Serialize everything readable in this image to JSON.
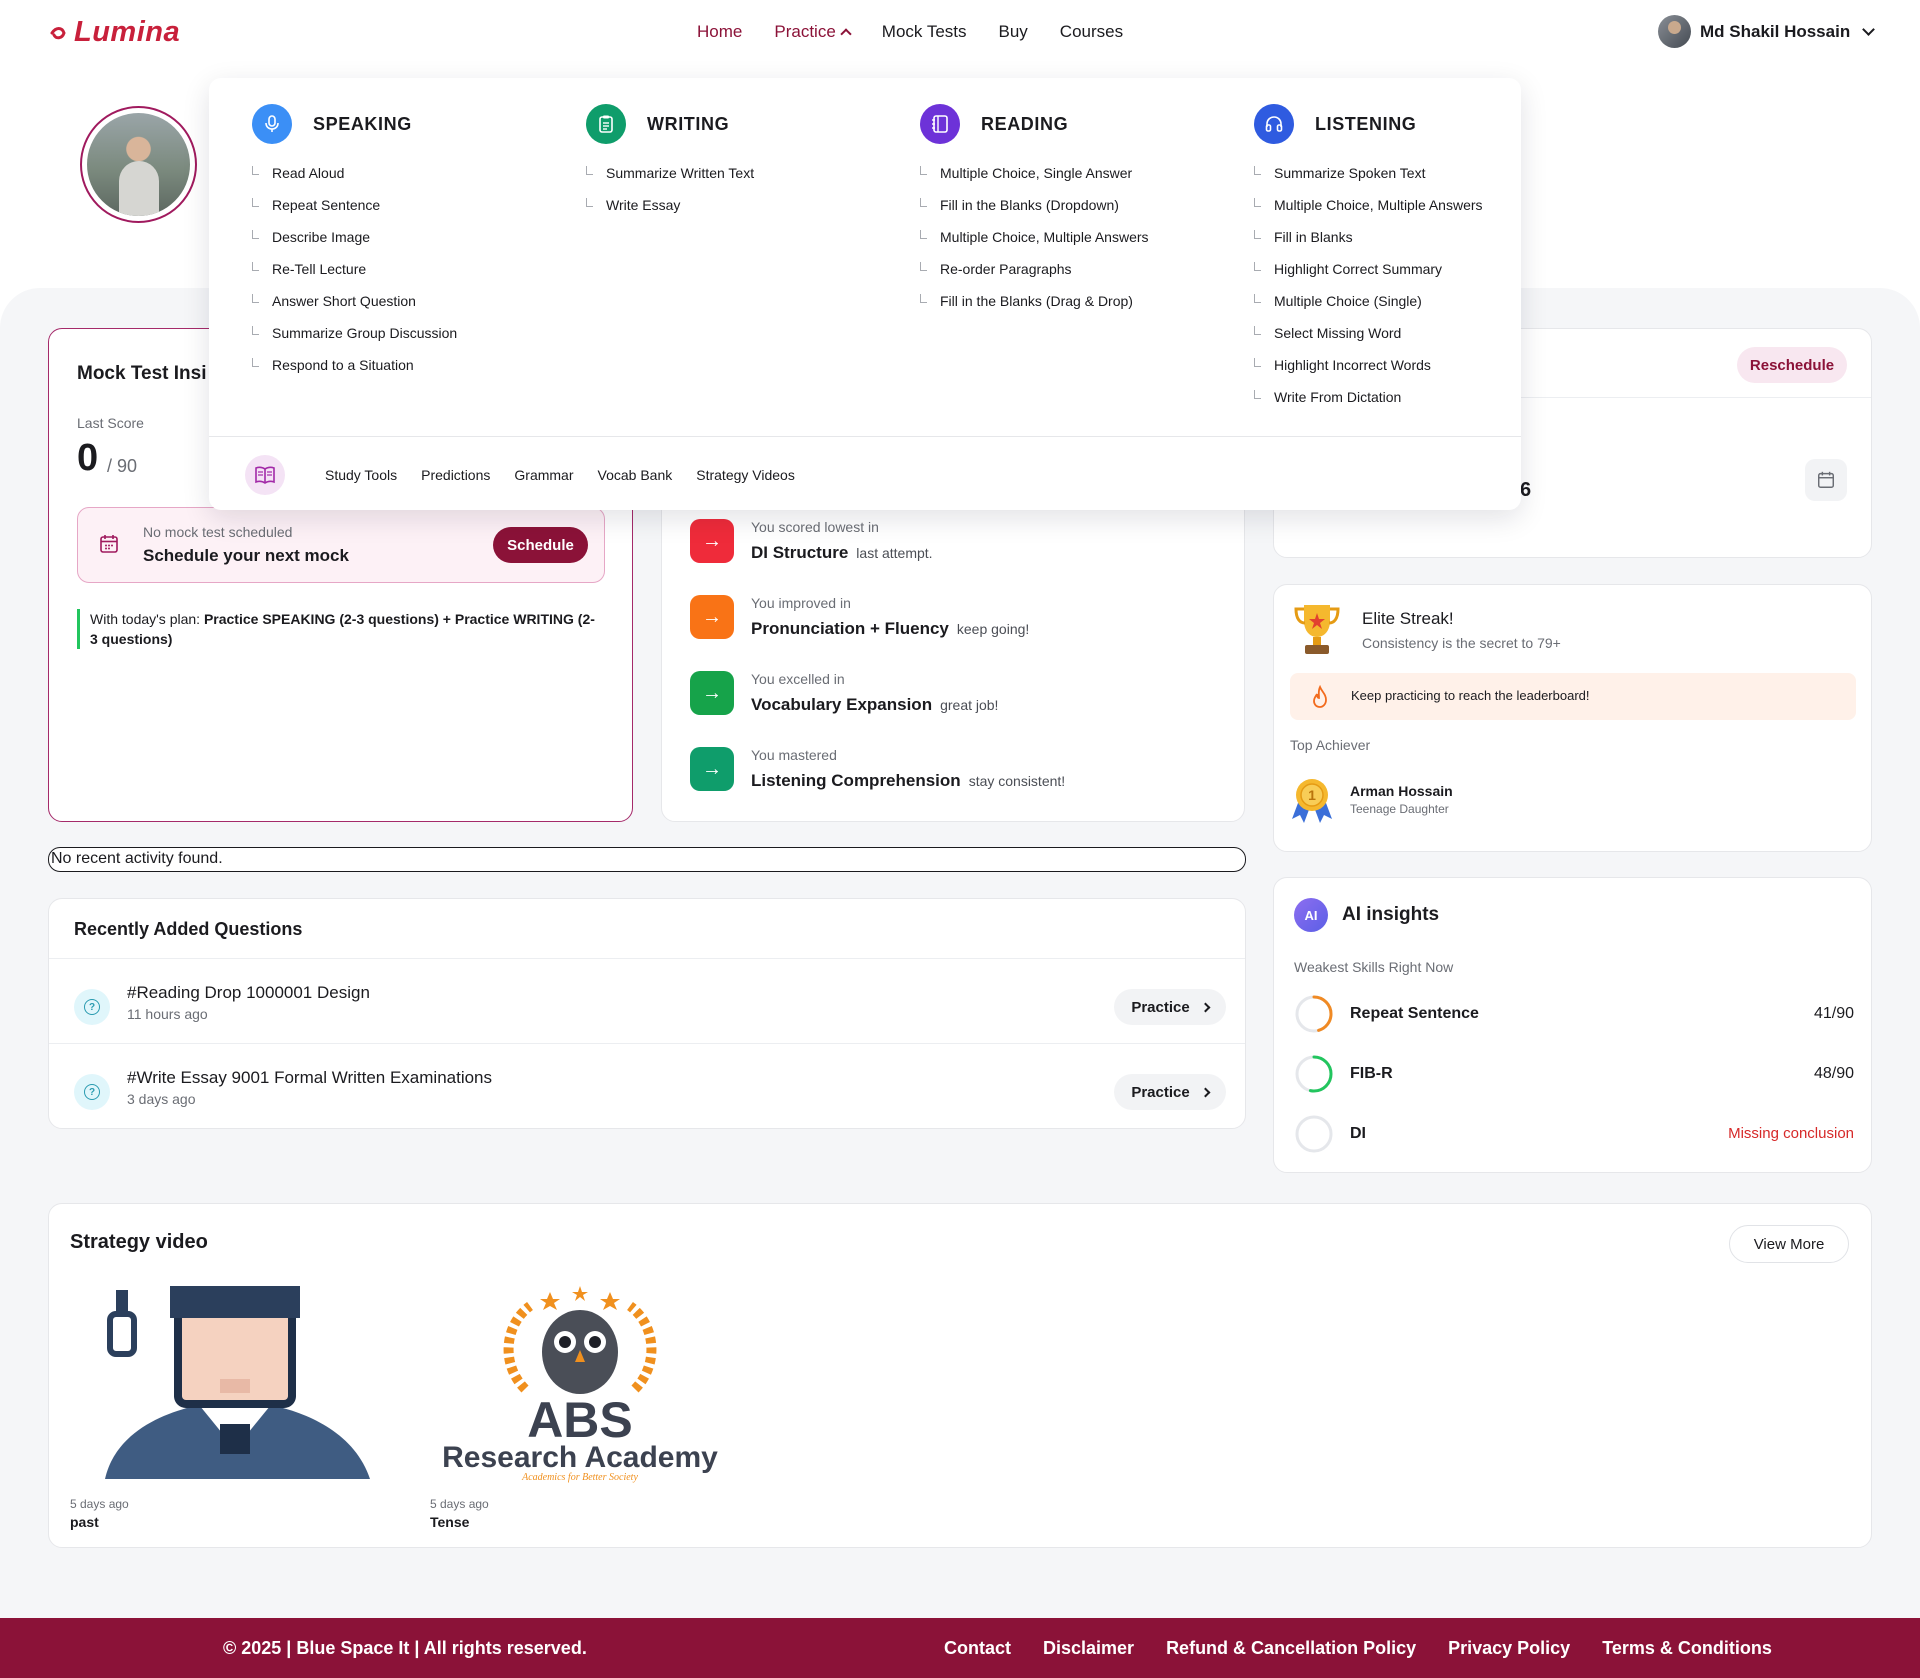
{
  "header": {
    "logo": "Lumina",
    "nav": [
      {
        "label": "Home",
        "active": true
      },
      {
        "label": "Practice",
        "active": true
      },
      {
        "label": "Mock Tests",
        "active": false
      },
      {
        "label": "Buy",
        "active": false
      },
      {
        "label": "Courses",
        "active": false
      }
    ],
    "user_name": "Md Shakil Hossain"
  },
  "colors": {
    "brand": "#8b1238",
    "logo": "#c8203b",
    "speaking": "#3b8ff6",
    "writing": "#0f9d6b",
    "reading": "#6d32d8",
    "listening": "#2f5be0"
  },
  "mega_menu": {
    "columns": [
      {
        "title": "SPEAKING",
        "icon": "microphone-icon",
        "items": [
          "Read Aloud",
          "Repeat Sentence",
          "Describe Image",
          "Re-Tell Lecture",
          "Answer Short Question",
          "Summarize Group Discussion",
          "Respond to a Situation"
        ]
      },
      {
        "title": "WRITING",
        "icon": "clipboard-icon",
        "items": [
          "Summarize Written Text",
          "Write Essay"
        ]
      },
      {
        "title": "READING",
        "icon": "notebook-icon",
        "items": [
          "Multiple Choice, Single Answer",
          "Fill in the Blanks (Dropdown)",
          "Multiple Choice, Multiple Answers",
          "Re-order Paragraphs",
          "Fill in the Blanks (Drag & Drop)"
        ]
      },
      {
        "title": "LISTENING",
        "icon": "headphones-icon",
        "items": [
          "Summarize Spoken Text",
          "Multiple Choice, Multiple Answers",
          "Fill in Blanks",
          "Highlight Correct Summary",
          "Multiple Choice (Single)",
          "Select Missing Word",
          "Highlight Incorrect Words",
          "Write From Dictation"
        ]
      }
    ],
    "bottom_links": [
      "Study Tools",
      "Predictions",
      "Grammar",
      "Vocab Bank",
      "Strategy Videos"
    ]
  },
  "mock_card": {
    "title": "Mock Test Insi",
    "last_score_label": "Last Score",
    "score": "0",
    "score_total": "/ 90",
    "schedule_sub": "No mock test scheduled",
    "schedule_main": "Schedule your next mock",
    "schedule_button": "Schedule",
    "plan_prefix": "With today's plan: ",
    "plan_text": "Practice SPEAKING (2-3 questions) + Practice WRITING (2-3 questions)"
  },
  "improvements": [
    {
      "pre": "You scored lowest in",
      "strong": "DI Structure",
      "tail": "last attempt.",
      "color": "#ef2b3a"
    },
    {
      "pre": "You improved in",
      "strong": "Pronunciation + Fluency",
      "tail": "keep going!",
      "color": "#f97316"
    },
    {
      "pre": "You excelled in",
      "strong": "Vocabulary Expansion",
      "tail": "great job!",
      "color": "#16a34a"
    },
    {
      "pre": "You mastered",
      "strong": "Listening Comprehension",
      "tail": "stay consistent!",
      "color": "#0f9d6b"
    }
  ],
  "schedule_card": {
    "reschedule_button": "Reschedule",
    "partial_number": "6"
  },
  "streak": {
    "title": "Elite Streak!",
    "subtitle": "Consistency is the secret to 79+",
    "banner": "Keep practicing to reach the leaderboard!",
    "top_achiever_label": "Top Achiever",
    "achiever_name": "Arman Hossain",
    "achiever_sub": "Teenage Daughter",
    "medal_rank": "1"
  },
  "ai_insights": {
    "badge": "AI",
    "title": "AI insights",
    "subtitle": "Weakest Skills Right Now",
    "skills": [
      {
        "name": "Repeat Sentence",
        "value": "41/90",
        "progress": 0.4556,
        "color": "#f08a24",
        "warn": false
      },
      {
        "name": "FIB-R",
        "value": "48/90",
        "progress": 0.5333,
        "color": "#22c55e",
        "warn": false
      },
      {
        "name": "DI",
        "value": "Missing conclusion",
        "progress": 0,
        "color": "#d1d5db",
        "warn": true
      }
    ]
  },
  "activity": {
    "empty_text": "No recent activity found."
  },
  "recent_questions": {
    "title": "Recently Added Questions",
    "button_label": "Practice",
    "items": [
      {
        "title": "#Reading Drop 1000001 Design",
        "time": "11 hours ago"
      },
      {
        "title": "#Write Essay 9001 Formal Written Examinations",
        "time": "3 days ago"
      }
    ]
  },
  "strategy_video": {
    "title": "Strategy video",
    "view_more": "View More",
    "videos": [
      {
        "ago": "5 days ago",
        "title": "past"
      },
      {
        "ago": "5 days ago",
        "title": "Tense",
        "logo_main": "ABS",
        "logo_sub": "Research Academy",
        "logo_tagline": "Academics for Better Society"
      }
    ]
  },
  "footer": {
    "copyright": "© 2025 | Blue Space It | All rights reserved.",
    "links": [
      "Contact",
      "Disclaimer",
      "Refund & Cancellation Policy",
      "Privacy Policy",
      "Terms & Conditions"
    ]
  }
}
